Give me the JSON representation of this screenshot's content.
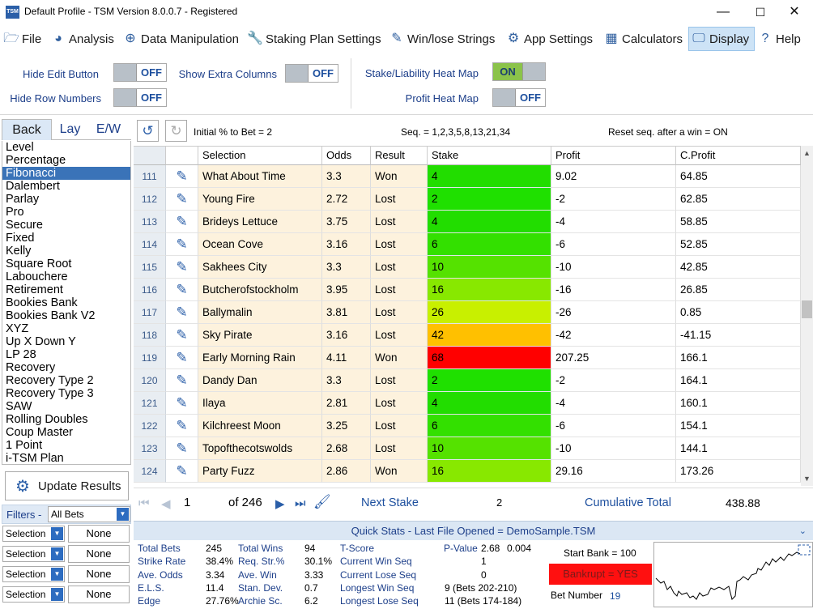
{
  "window": {
    "title": "Default Profile  - TSM Version 8.0.0.7 - Registered",
    "icon_text": "TSM",
    "min": "—",
    "max": "☐",
    "close": "✕"
  },
  "menu": [
    {
      "label": "File",
      "icon": "folder-icon",
      "glyph": "🗁"
    },
    {
      "label": "Analysis",
      "icon": "pie-chart-icon",
      "glyph": "◕"
    },
    {
      "label": "Data Manipulation",
      "icon": "plus-circle-icon",
      "glyph": "⊕"
    },
    {
      "label": "Staking Plan Settings",
      "icon": "wrench-icon",
      "glyph": "🔧"
    },
    {
      "label": "Win/lose Strings",
      "icon": "edit-icon",
      "glyph": "✎"
    },
    {
      "label": "App Settings",
      "icon": "gear-icon",
      "glyph": "⚙"
    },
    {
      "label": "Calculators",
      "icon": "calculator-icon",
      "glyph": "▦"
    },
    {
      "label": "Display",
      "icon": "monitor-icon",
      "glyph": "🖵"
    },
    {
      "label": "Help",
      "icon": "help-icon",
      "glyph": "?"
    }
  ],
  "display": {
    "hide_edit_button": {
      "label": "Hide Edit Button",
      "state": "OFF"
    },
    "show_extra_columns": {
      "label": "Show Extra Columns",
      "state": "OFF"
    },
    "hide_row_numbers": {
      "label": "Hide Row Numbers",
      "state": "OFF"
    },
    "stake_heat_map": {
      "label": "Stake/Liability Heat Map",
      "state": "ON"
    },
    "profit_heat_map": {
      "label": "Profit Heat Map",
      "state": "OFF"
    }
  },
  "left": {
    "tabs": [
      "Back",
      "Lay",
      "E/W"
    ],
    "plans": [
      "Level",
      "Percentage",
      "Fibonacci",
      "Dalembert",
      "Parlay",
      "Pro",
      "Secure",
      "Fixed",
      "Kelly",
      "Square Root",
      "Labouchere",
      "Retirement",
      "Bookies Bank",
      "Bookies Bank V2",
      "XYZ",
      "Up X Down Y",
      "LP 28",
      "Recovery",
      "Recovery Type 2",
      "Recovery Type 3",
      "SAW",
      "Rolling Doubles",
      "Coup Master",
      "1 Point",
      "i-TSM Plan"
    ],
    "selected_plan": "Fibonacci",
    "update_button": "Update Results",
    "filters_label": "Filters -",
    "filters_value": "All Bets",
    "filter_rows": [
      {
        "field": "Selection",
        "value": "None"
      },
      {
        "field": "Selection",
        "value": "None"
      },
      {
        "field": "Selection",
        "value": "None"
      },
      {
        "field": "Selection",
        "value": "None"
      }
    ]
  },
  "toolbar": {
    "initial_pct": "Initial % to Bet = 2",
    "sequence": "Seq. = 1,2,3,5,8,13,21,34",
    "reset": "Reset seq. after a win = ON"
  },
  "grid": {
    "columns": [
      "Selection",
      "Odds",
      "Result",
      "Stake",
      "Profit",
      "C.Profit"
    ],
    "rows": [
      {
        "n": "111",
        "sel": "What About Time",
        "odds": "3.3",
        "res": "Won",
        "stake": "4",
        "profit": "9.02",
        "cprofit": "64.85",
        "color": "#22dd00"
      },
      {
        "n": "112",
        "sel": "Young Fire",
        "odds": "2.72",
        "res": "Lost",
        "stake": "2",
        "profit": "-2",
        "cprofit": "62.85",
        "color": "#1fe000"
      },
      {
        "n": "113",
        "sel": "Brideys Lettuce",
        "odds": "3.75",
        "res": "Lost",
        "stake": "4",
        "profit": "-4",
        "cprofit": "58.85",
        "color": "#22dd00"
      },
      {
        "n": "114",
        "sel": "Ocean Cove",
        "odds": "3.16",
        "res": "Lost",
        "stake": "6",
        "profit": "-6",
        "cprofit": "52.85",
        "color": "#33e000"
      },
      {
        "n": "115",
        "sel": "Sakhees City",
        "odds": "3.3",
        "res": "Lost",
        "stake": "10",
        "profit": "-10",
        "cprofit": "42.85",
        "color": "#55e200"
      },
      {
        "n": "116",
        "sel": "Butcherofstockholm",
        "odds": "3.95",
        "res": "Lost",
        "stake": "16",
        "profit": "-16",
        "cprofit": "26.85",
        "color": "#88e800"
      },
      {
        "n": "117",
        "sel": "Ballymalin",
        "odds": "3.81",
        "res": "Lost",
        "stake": "26",
        "profit": "-26",
        "cprofit": "0.85",
        "color": "#c8f000"
      },
      {
        "n": "118",
        "sel": "Sky Pirate",
        "odds": "3.16",
        "res": "Lost",
        "stake": "42",
        "profit": "-42",
        "cprofit": "-41.15",
        "color": "#ffc000"
      },
      {
        "n": "119",
        "sel": "Early Morning Rain",
        "odds": "4.11",
        "res": "Won",
        "stake": "68",
        "profit": "207.25",
        "cprofit": "166.1",
        "color": "#ff0000"
      },
      {
        "n": "120",
        "sel": "Dandy Dan",
        "odds": "3.3",
        "res": "Lost",
        "stake": "2",
        "profit": "-2",
        "cprofit": "164.1",
        "color": "#1fe000"
      },
      {
        "n": "121",
        "sel": "Ilaya",
        "odds": "2.81",
        "res": "Lost",
        "stake": "4",
        "profit": "-4",
        "cprofit": "160.1",
        "color": "#22dd00"
      },
      {
        "n": "122",
        "sel": "Kilchreest Moon",
        "odds": "3.25",
        "res": "Lost",
        "stake": "6",
        "profit": "-6",
        "cprofit": "154.1",
        "color": "#33e000"
      },
      {
        "n": "123",
        "sel": "Topofthecotswolds",
        "odds": "2.68",
        "res": "Lost",
        "stake": "10",
        "profit": "-10",
        "cprofit": "144.1",
        "color": "#55e200"
      },
      {
        "n": "124",
        "sel": "Party Fuzz",
        "odds": "2.86",
        "res": "Won",
        "stake": "16",
        "profit": "29.16",
        "cprofit": "173.26",
        "color": "#88e800"
      }
    ]
  },
  "nav": {
    "page": "1",
    "of": "of 246",
    "next_stake_label": "Next Stake",
    "next_stake": "2",
    "cum_label": "Cumulative Total",
    "cum": "438.88"
  },
  "quick_stats": {
    "header": "Quick Stats - Last File Opened = DemoSample.TSM",
    "col1": [
      {
        "l": "Total Bets",
        "v": "245"
      },
      {
        "l": "Strike Rate",
        "v": "38.4%"
      },
      {
        "l": "Ave. Odds",
        "v": "3.34"
      },
      {
        "l": "E.L.S.",
        "v": "11.4"
      },
      {
        "l": "Edge",
        "v": "27.76%"
      }
    ],
    "col2": [
      {
        "l": "Total Wins",
        "v": "94"
      },
      {
        "l": "Req. Str.%",
        "v": "30.1%"
      },
      {
        "l": "Ave. Win",
        "v": "3.33"
      },
      {
        "l": "Stan. Dev.",
        "v": "0.7"
      },
      {
        "l": "Archie Sc.",
        "v": "6.2"
      }
    ],
    "col3": [
      {
        "l": "T-Score",
        "v": "2.68"
      },
      {
        "l": "Current Win Seq",
        "v": "1"
      },
      {
        "l": "Current Lose Seq",
        "v": "0"
      },
      {
        "l": "Longest Win Seq",
        "v": "9  (Bets 202-210)"
      },
      {
        "l": "Longest Lose Seq",
        "v": "11  (Bets 174-184)"
      }
    ],
    "pvalue": {
      "l": "P-Value",
      "v": "0.004"
    },
    "start_bank": "Start Bank = 100",
    "bankrupt": "Bankrupt = YES",
    "bet_number_label": "Bet Number",
    "bet_number": "19"
  }
}
